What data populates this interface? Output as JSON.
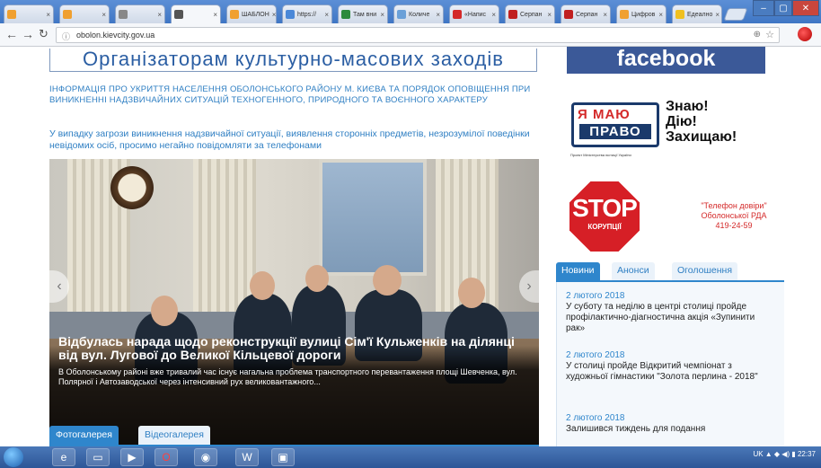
{
  "browser": {
    "tabs": [
      {
        "label": "",
        "color": "#f0a030"
      },
      {
        "label": "",
        "color": "#f0a030"
      },
      {
        "label": "",
        "color": "#888888"
      },
      {
        "label": "",
        "color": "#555555"
      },
      {
        "label": "ШАБЛОН",
        "color": "#f0a030"
      },
      {
        "label": "https://",
        "color": "#4a88d8"
      },
      {
        "label": "Там вни",
        "color": "#2c8a3c"
      },
      {
        "label": "Количе",
        "color": "#6aa0d8"
      },
      {
        "label": "«Напис",
        "color": "#d42a2a"
      },
      {
        "label": "Серпан",
        "color": "#c02020"
      },
      {
        "label": "Серпан",
        "color": "#c02020"
      },
      {
        "label": "Цифров",
        "color": "#f0a030"
      },
      {
        "label": "Едеално",
        "color": "#f0c020"
      }
    ],
    "url": "obolon.kievcity.gov.ua"
  },
  "page": {
    "title": "Організаторам культурно-масових заходів",
    "info_link": "Інформація про укриття населення Оболонського району м. Києва та порядок оповіщення при виникненні надзвичайних ситуацій техногенного, природного та воєнного характеру",
    "alert": "У випадку загрози виникнення надзвичайної ситуації, виявлення сторонніх предметів, незрозумілої поведінки невідомих осіб, просимо негайно повідомляти за телефонами",
    "slide": {
      "title": "Відбулась нарада щодо реконструкції вулиці Сім'ї Кульженків на ділянці від вул. Лугової до Великої Кільцевої дороги",
      "text": "В Оболонському районі вже тривалий час існує нагальна проблема транспортного перевантаження площі Шевченка, вул. Полярної і Автозаводської через інтенсивний рух великовантажного..."
    },
    "gallery_tabs": [
      "Фотогалерея",
      "Відеогалерея"
    ]
  },
  "sidebar": {
    "facebook": "facebook",
    "pravo": {
      "line1": "Я МАЮ",
      "line2": "ПРАВО",
      "caption": "Проект Міністерства юстиції України",
      "slogan": [
        "Знаю!",
        "Дію!",
        "Захищаю!"
      ]
    },
    "stop": {
      "word": "STOP",
      "sub": "КОРУПЦІЇ"
    },
    "hotline": [
      "\"Телефон довіри\"",
      "Оболонської РДА",
      "419-24-59"
    ],
    "news_tabs": [
      "Новини",
      "Анонси",
      "Оголошення"
    ],
    "news": [
      {
        "date": "2 лютого 2018",
        "text": "У суботу та неділю в центрі столиці пройде профілактично-діагностична акція «Зупинити рак»"
      },
      {
        "date": "2 лютого 2018",
        "text": "У столиці пройде Відкритий чемпіонат з художньої гімнастики \"Золота перлина - 2018\""
      },
      {
        "date": "2 лютого 2018",
        "text": "Залишився тиждень для подання"
      }
    ]
  },
  "taskbar": {
    "tray": "UK  ▲  ◆  ◀)  ▮   22:37"
  }
}
